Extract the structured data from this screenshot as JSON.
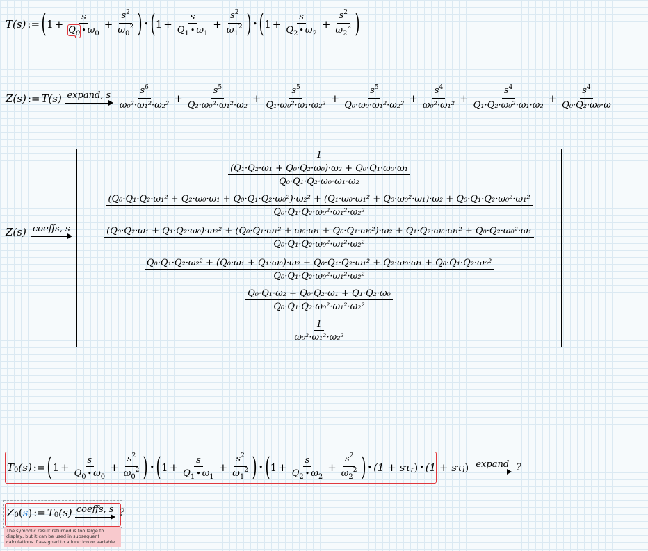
{
  "worksheet": {
    "t_def": {
      "lhs": "T(s)",
      "assign": ":=",
      "factors": [
        {
          "q": "Q",
          "q_sub": "0",
          "w": "ω",
          "w_sub": "0"
        },
        {
          "q": "Q",
          "q_sub": "1",
          "w": "ω",
          "w_sub": "1"
        },
        {
          "q": "Q",
          "q_sub": "2",
          "w": "ω",
          "w_sub": "2"
        }
      ]
    },
    "z_expand": {
      "lhs": "Z(s)",
      "assign": ":=",
      "rhs": "T(s)",
      "keyword": "expand, s",
      "terms": [
        {
          "num": "s",
          "num_exp": "6",
          "den": "ω₀²·ω₁²·ω₂²"
        },
        {
          "num": "s",
          "num_exp": "5",
          "den": "Q₂·ω₀²·ω₁²·ω₂"
        },
        {
          "num": "s",
          "num_exp": "5",
          "den": "Q₁·ω₀²·ω₁·ω₂²"
        },
        {
          "num": "s",
          "num_exp": "5",
          "den": "Q₀·ω₀·ω₁²·ω₂²"
        },
        {
          "num": "s",
          "num_exp": "4",
          "den": "ω₀²·ω₁²"
        },
        {
          "num": "s",
          "num_exp": "4",
          "den": "Q₁·Q₂·ω₀²·ω₁·ω₂"
        },
        {
          "num": "s",
          "num_exp": "4",
          "den": "Q₀·Q₂·ω₀·ω"
        }
      ]
    },
    "z_coeffs": {
      "lhs": "Z(s)",
      "keyword": "coeffs, s",
      "rows": [
        {
          "num": "1",
          "den": ""
        },
        {
          "num": "(Q₁·Q₂·ω₁ + Q₀·Q₂·ω₀)·ω₂ + Q₀·Q₁·ω₀·ω₁",
          "den": "Q₀·Q₁·Q₂·ω₀·ω₁·ω₂"
        },
        {
          "num": "(Q₀·Q₁·Q₂·ω₁² + Q₂·ω₀·ω₁ + Q₀·Q₁·Q₂·ω₀²)·ω₂² + (Q₁·ω₀·ω₁² + Q₀·ω₀²·ω₁)·ω₂ + Q₀·Q₁·Q₂·ω₀²·ω₁²",
          "den": "Q₀·Q₁·Q₂·ω₀²·ω₁²·ω₂²"
        },
        {
          "num": "(Q₀·Q₂·ω₁ + Q₁·Q₂·ω₀)·ω₂² + (Q₀·Q₁·ω₁² + ω₀·ω₁ + Q₀·Q₁·ω₀²)·ω₂ + Q₁·Q₂·ω₀·ω₁² + Q₀·Q₂·ω₀²·ω₁",
          "den": "Q₀·Q₁·Q₂·ω₀²·ω₁²·ω₂²"
        },
        {
          "num": "Q₀·Q₁·Q₂·ω₂² + (Q₀·ω₁ + Q₁·ω₀)·ω₂ + Q₀·Q₁·Q₂·ω₁² + Q₂·ω₀·ω₁ + Q₀·Q₁·Q₂·ω₀²",
          "den": "Q₀·Q₁·Q₂·ω₀²·ω₁²·ω₂²"
        },
        {
          "num": "Q₀·Q₁·ω₂ + Q₀·Q₂·ω₁ + Q₁·Q₂·ω₀",
          "den": "Q₀·Q₁·Q₂·ω₀²·ω₁²·ω₂²"
        },
        {
          "num": "1",
          "den": "ω₀²·ω₁²·ω₂²"
        }
      ]
    },
    "t0_def": {
      "lhs_base": "T",
      "lhs_sub": "0",
      "lhs_arg": "(s)",
      "assign": ":=",
      "extra_factors": [
        "(1 + sτ",
        "r",
        ")",
        "(1 + sτ",
        "l",
        ")"
      ],
      "keyword": "expand",
      "result": "?"
    },
    "z0_def": {
      "lhs_base": "Z",
      "lhs_sub": "0",
      "lhs_arg": "s",
      "assign": ":=",
      "rhs_base": "T",
      "rhs_sub": "0",
      "rhs_arg": "(s)",
      "keyword": "coeffs, s",
      "result": "?",
      "error": "The symbolic result returned is too large to display, but it can be used in subsequent calculations if assigned to a function or variable."
    },
    "common": {
      "one": "1",
      "plus": "+",
      "s": "s",
      "sq": "2",
      "dot": "·"
    }
  }
}
